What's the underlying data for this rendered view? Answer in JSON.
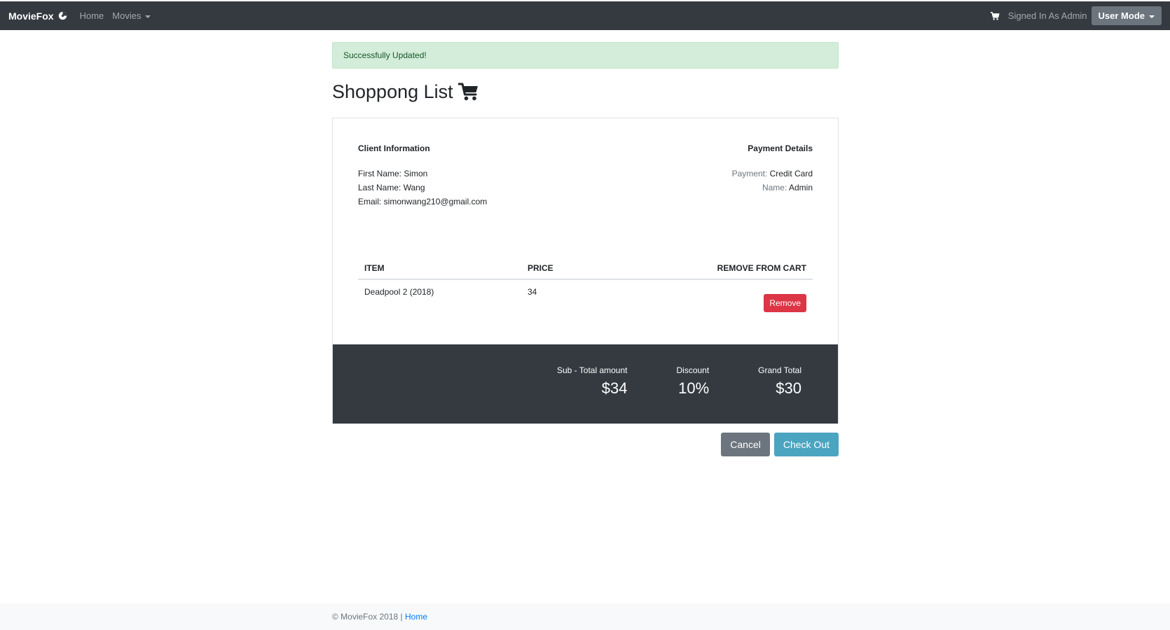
{
  "navbar": {
    "brand": "MovieFox",
    "links": [
      "Home",
      "Movies"
    ],
    "signed_in": "Signed In As Admin",
    "user_mode": "User Mode"
  },
  "alert": {
    "text": "Successfully Updated!"
  },
  "page": {
    "title": "Shoppong List"
  },
  "client": {
    "heading": "Client Information",
    "first_name": "First Name: Simon",
    "last_name": "Last Name: Wang",
    "email": "Email: simonwang210@gmail.com"
  },
  "payment": {
    "heading": "Payment Details",
    "payment_label": "Payment:",
    "payment_value": "Credit Card",
    "name_label": "Name:",
    "name_value": "Admin"
  },
  "table": {
    "headers": [
      "ITEM",
      "PRICE",
      "REMOVE FROM CART"
    ],
    "rows": [
      {
        "item": "Deadpool 2 (2018)",
        "price": "34",
        "action": "Remove"
      }
    ]
  },
  "totals": {
    "subtotal_label": "Sub - Total amount",
    "subtotal_value": "$34",
    "discount_label": "Discount",
    "discount_value": "10%",
    "grand_label": "Grand Total",
    "grand_value": "$30"
  },
  "actions": {
    "cancel": "Cancel",
    "checkout": "Check Out"
  },
  "footer": {
    "copyright": "© MovieFox 2018 |",
    "link": "Home"
  },
  "icons": [
    "logo-icon",
    "cart-icon",
    "shopping-cart-icon",
    "chevron-down-icon"
  ],
  "colors": {
    "navbar": "#343a40",
    "alert_bg": "#d4edda",
    "remove": "#dc3545",
    "cancel": "#6c757d",
    "checkout": "#4ba4c0",
    "link": "#007bff"
  }
}
